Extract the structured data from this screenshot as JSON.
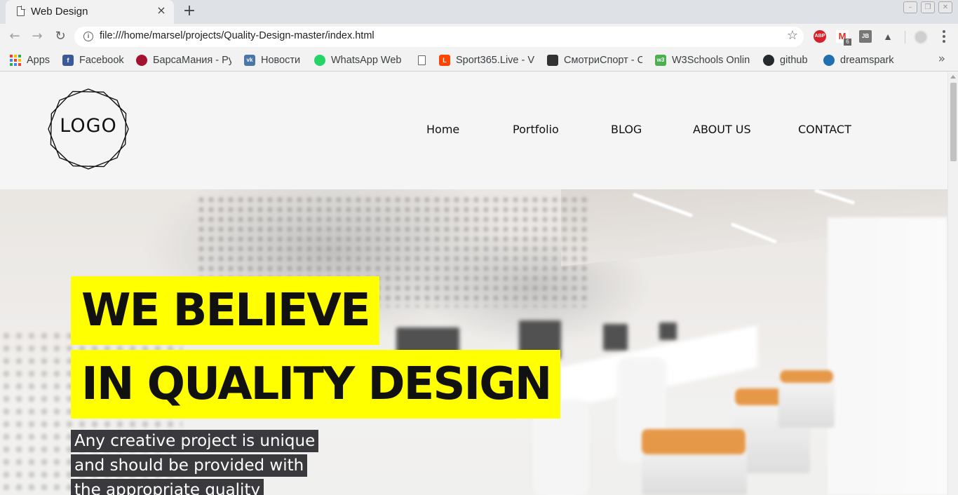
{
  "browser": {
    "tab_title": "Web Design",
    "tab_close": "×",
    "new_tab": "+",
    "url": "file:///home/marsel/projects/Quality-Design-master/index.html",
    "info_glyph": "i",
    "star_glyph": "☆",
    "nav": {
      "back": "←",
      "forward": "→",
      "reload": "↻"
    },
    "window_controls": {
      "minimize": "–",
      "restore": "❐",
      "close": "✕"
    },
    "extensions": [
      {
        "name": "adblock-plus-icon",
        "label": "ABP",
        "color": "#d9202a"
      },
      {
        "name": "gmail-icon",
        "label": "M",
        "color": "#d93025",
        "badge": "6"
      },
      {
        "name": "jetbrains-icon",
        "label": "JB",
        "color": "#777777"
      },
      {
        "name": "extension-icon",
        "label": "▲",
        "color": "#555555"
      },
      {
        "name": "profile-icon",
        "label": "",
        "color": "#cccccc"
      }
    ],
    "bookmarks": [
      {
        "label": "Apps",
        "icon": "apps-grid-icon",
        "color": "#4285f4"
      },
      {
        "label": "Facebook",
        "icon": "facebook-icon",
        "color": "#3b5998"
      },
      {
        "label": "БарсаМания - Ру",
        "icon": "barcamania-icon",
        "color": "#a3122e"
      },
      {
        "label": "Новости",
        "icon": "vk-icon",
        "color": "#4a76a8"
      },
      {
        "label": "WhatsApp Web",
        "icon": "whatsapp-icon",
        "color": "#25d366"
      },
      {
        "label": "",
        "icon": "blank-page-icon",
        "color": "#ffffff"
      },
      {
        "label": "Sport365.Live - V",
        "icon": "sport365-icon",
        "color": "#ff4500"
      },
      {
        "label": "СмотриСпорт - С",
        "icon": "smotrisport-icon",
        "color": "#333333"
      },
      {
        "label": "W3Schools Onlin",
        "icon": "w3schools-icon",
        "color": "#4caf50"
      },
      {
        "label": "github",
        "icon": "github-icon",
        "color": "#24292e"
      },
      {
        "label": "dreamspark",
        "icon": "dreamspark-icon",
        "color": "#1f6fb2"
      }
    ],
    "more_bookmarks": "»"
  },
  "site": {
    "logo_text": "LOGO",
    "nav": [
      "Home",
      "Portfolio",
      "BLOG",
      "ABOUT US",
      "CONTACT"
    ],
    "hero": {
      "headline_1": "WE BELIEVE",
      "headline_2": "IN QUALITY DESIGN",
      "sub_1": "Any creative project is unique",
      "sub_2": "and should be provided with",
      "sub_3": "the appropriate quality",
      "accent_color": "#ffff00"
    }
  }
}
